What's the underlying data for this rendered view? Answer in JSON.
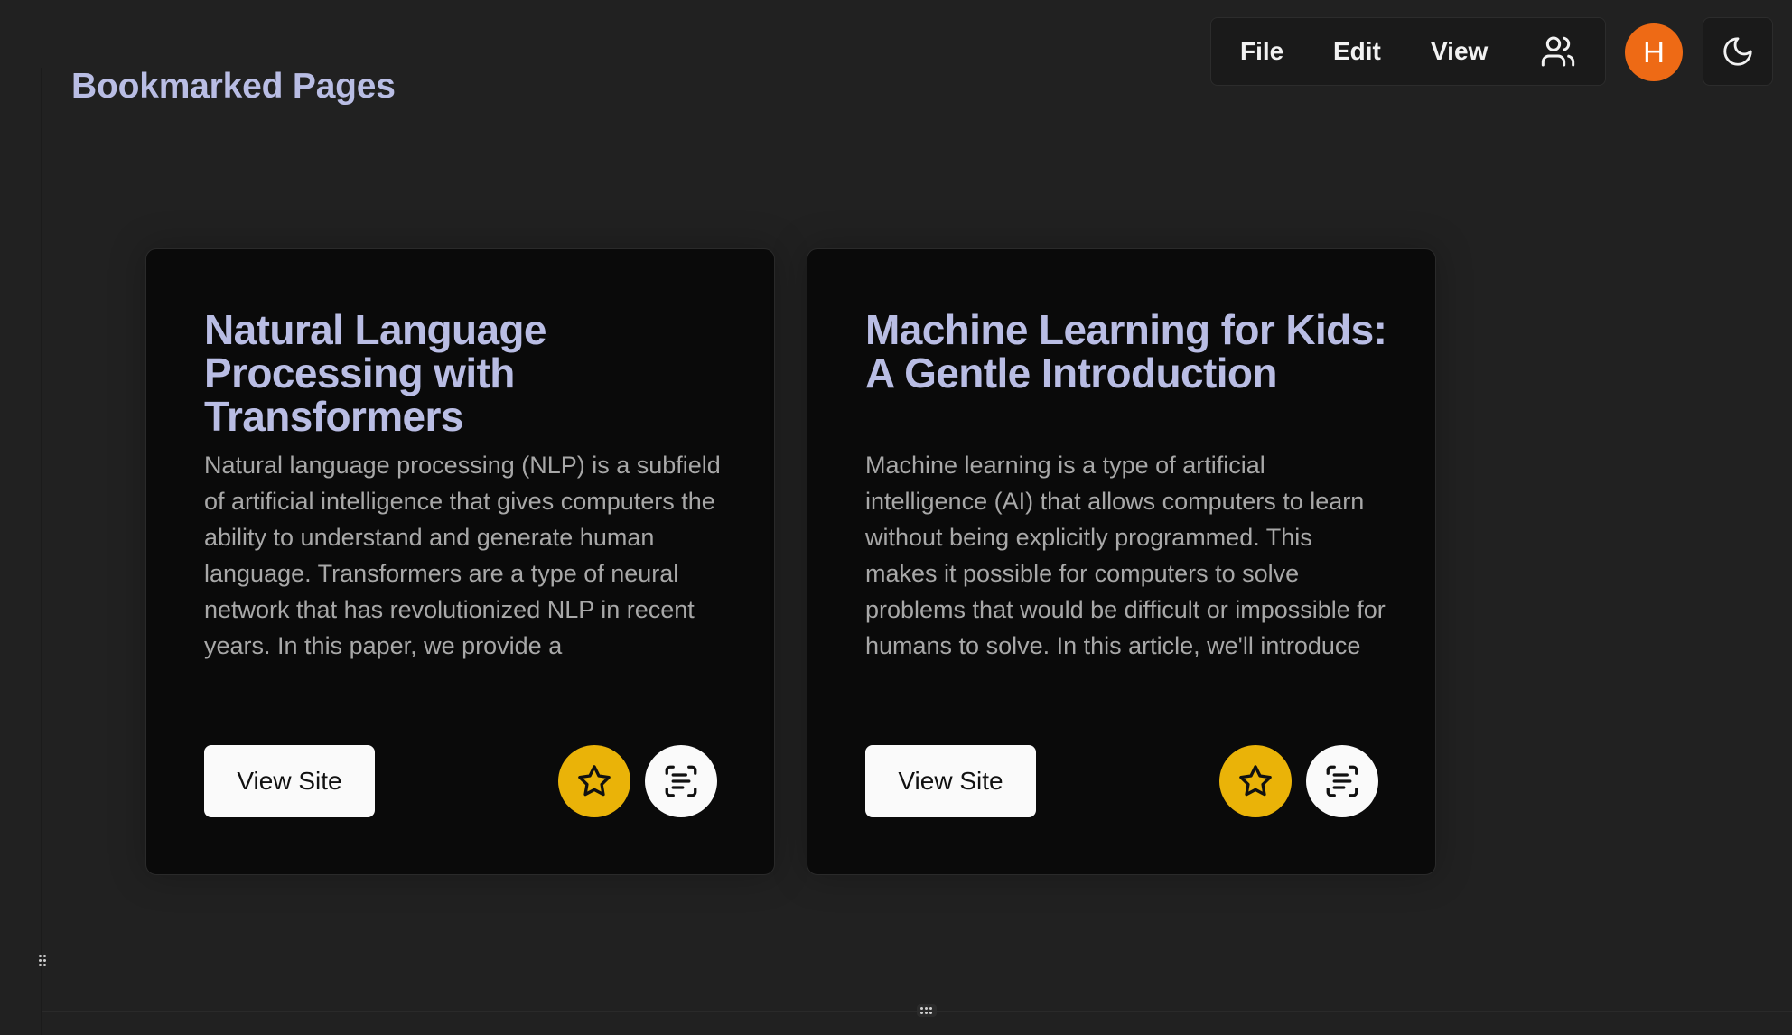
{
  "page": {
    "title": "Bookmarked Pages"
  },
  "menubar": {
    "file": "File",
    "edit": "Edit",
    "view": "View"
  },
  "user": {
    "avatar_initial": "H",
    "avatar_color": "#ee6a15"
  },
  "colors": {
    "background": "#212121",
    "card_background": "#0a0a0a",
    "title_accent": "#b9bde4",
    "star_button": "#eab308"
  },
  "icons": {
    "users": "users-icon",
    "theme": "moon-icon",
    "bookmark": "star-icon",
    "summarize": "scan-text-icon"
  },
  "cards": [
    {
      "title": "Natural Language Processing with Transformers",
      "description": "Natural language processing (NLP) is a subfield of artificial intelligence that gives computers the ability to understand and generate human language. Transformers are a type of neural network that has revolutionized NLP in recent years. In this paper, we provide a comprehensive",
      "button_label": "View Site"
    },
    {
      "title": "Machine Learning for Kids: A Gentle Introduction",
      "description": "Machine learning is a type of artificial intelligence (AI) that allows computers to learn without being explicitly programmed. This makes it possible for computers to solve problems that would be difficult or impossible for humans to solve. In this article, we'll introduce machine learning to",
      "button_label": "View Site"
    }
  ]
}
